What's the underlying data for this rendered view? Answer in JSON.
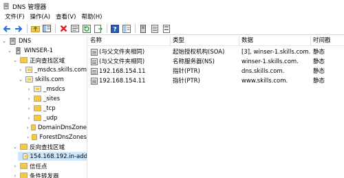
{
  "window": {
    "title": "DNS 管理器",
    "icon": "dns-manager-icon"
  },
  "menu": [
    {
      "label": "文件(F)"
    },
    {
      "label": "操作(A)"
    },
    {
      "label": "查看(V)"
    },
    {
      "label": "帮助(H)"
    }
  ],
  "toolbar": {
    "buttons": [
      "back-arrow-icon",
      "forward-arrow-icon",
      "up-folder-icon",
      "show-hide-console-tree-icon",
      "delete-icon",
      "properties-icon",
      "refresh-icon",
      "export-list-icon",
      "help-icon",
      "help-topics-icon",
      "server-icon",
      "record-icon",
      "filter-icon"
    ]
  },
  "tree": {
    "nodes": [
      {
        "label": "DNS",
        "expander": "chevron-down",
        "icon": "dns-root-icon"
      },
      {
        "label": "WINSER-1",
        "expander": "chevron-down",
        "icon": "server-icon"
      },
      {
        "label": "正向查找区域",
        "expander": "chevron-down",
        "icon": "folder-icon"
      },
      {
        "label": "_msdcs.skills.com",
        "expander": "chevron-right",
        "icon": "zone-icon"
      },
      {
        "label": "skills.com",
        "expander": "chevron-down",
        "icon": "zone-icon"
      },
      {
        "label": "_msdcs",
        "expander": "chevron-right",
        "icon": "delegated-folder-icon"
      },
      {
        "label": "_sites",
        "expander": "chevron-right",
        "icon": "folder-icon"
      },
      {
        "label": "_tcp",
        "expander": "chevron-right",
        "icon": "folder-icon"
      },
      {
        "label": "_udp",
        "expander": "chevron-right",
        "icon": "folder-icon"
      },
      {
        "label": "DomainDnsZone",
        "expander": "chevron-right",
        "icon": "folder-icon"
      },
      {
        "label": "ForestDnsZones",
        "expander": "chevron-right",
        "icon": "folder-icon"
      },
      {
        "label": "反向查找区域",
        "expander": "chevron-down",
        "icon": "folder-icon"
      },
      {
        "label": "154.168.192.in-add",
        "expander": "",
        "icon": "zone-icon",
        "selected": true
      },
      {
        "label": "信任点",
        "expander": "chevron-right",
        "icon": "folder-icon"
      },
      {
        "label": "条件转发器",
        "expander": "chevron-right",
        "icon": "folder-icon"
      }
    ]
  },
  "list": {
    "columns": [
      {
        "label": "名称"
      },
      {
        "label": "类型"
      },
      {
        "label": "数据"
      },
      {
        "label": "时间戳"
      }
    ],
    "rows": [
      {
        "name": "(与父文件夹相同)",
        "type": "起始授权机构(SOA)",
        "data": "[3], winser-1.skills.com.,...",
        "timestamp": "静态"
      },
      {
        "name": "(与父文件夹相同)",
        "type": "名称服务器(NS)",
        "data": "winser-1.skills.com.",
        "timestamp": "静态"
      },
      {
        "name": "192.168.154.11",
        "type": "指针(PTR)",
        "data": "dns.skills.com.",
        "timestamp": "静态"
      },
      {
        "name": "192.168.154.11",
        "type": "指针(PTR)",
        "data": "www.skills.com.",
        "timestamp": "静态"
      }
    ]
  },
  "colors": {
    "selection": "#cce8ff",
    "folder": "#f3c94d",
    "back_arrow": "#1e6fd9",
    "delete": "#d42020",
    "refresh": "#2f9e3a",
    "help": "#2a5db0"
  }
}
